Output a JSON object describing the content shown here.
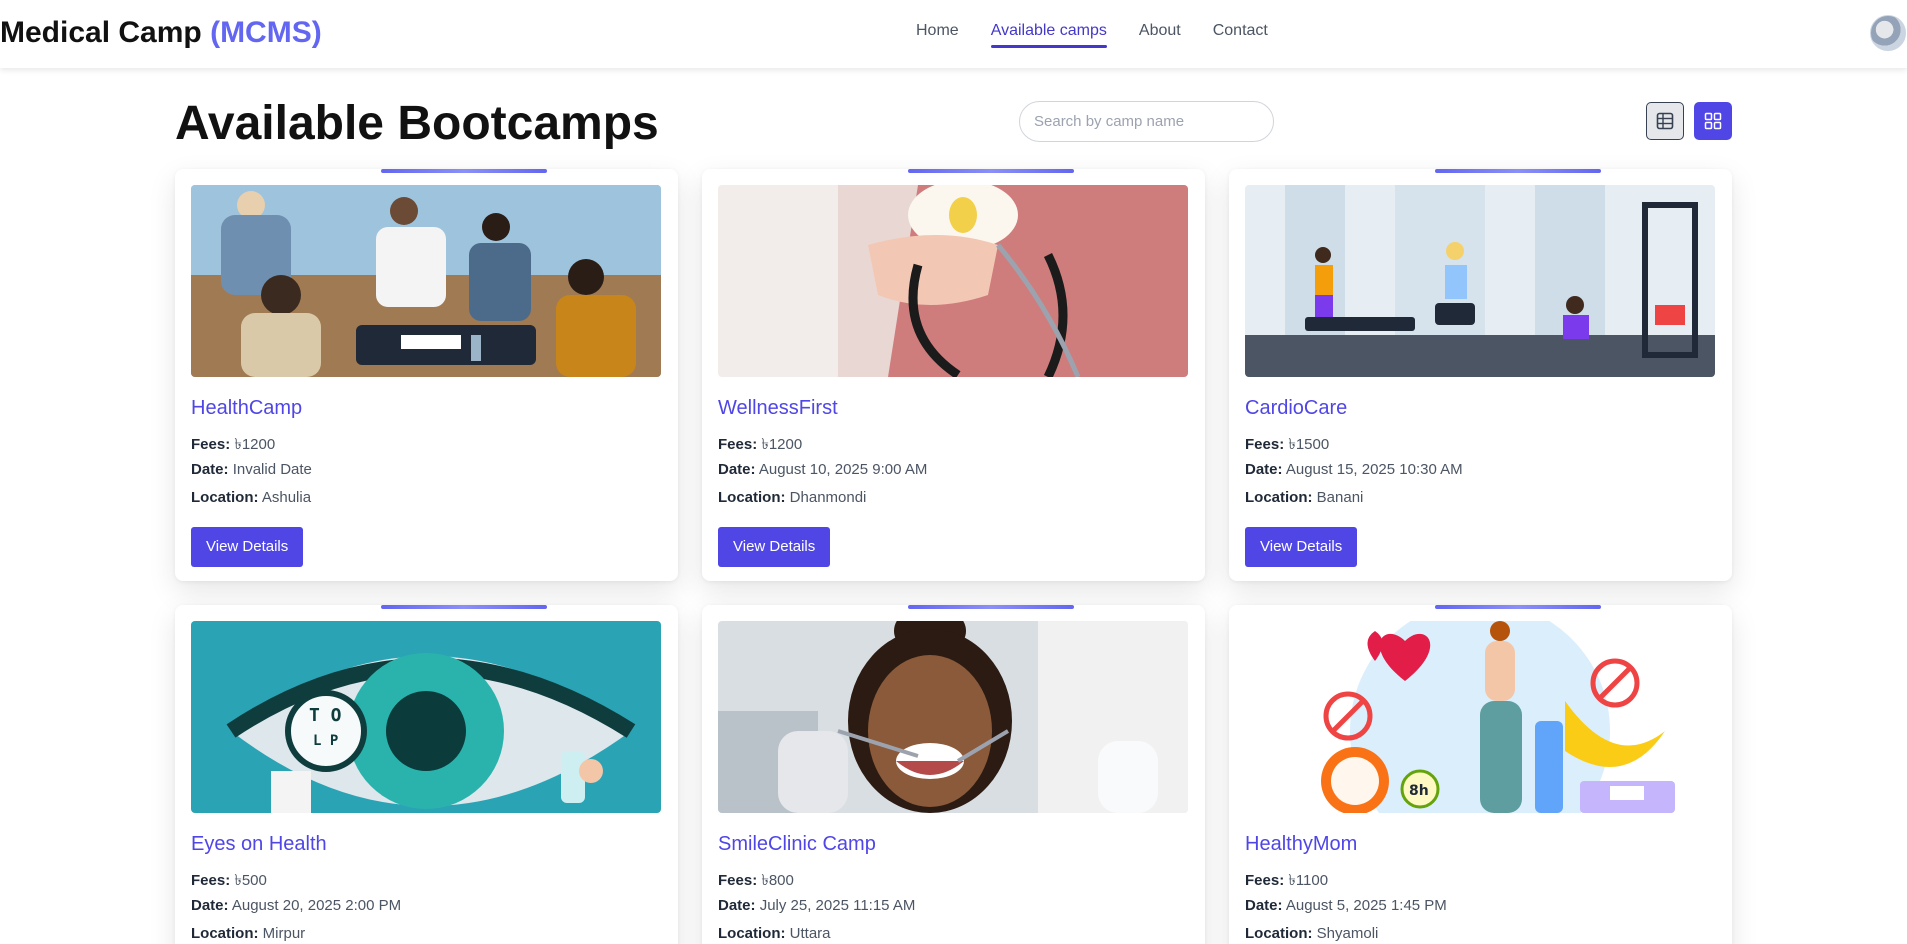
{
  "brand": {
    "name": "Medical Camp",
    "abbr": "(MCMS)"
  },
  "nav": {
    "items": [
      {
        "label": "Home"
      },
      {
        "label": "Available camps"
      },
      {
        "label": "About"
      },
      {
        "label": "Contact"
      }
    ],
    "active": "Available camps"
  },
  "page": {
    "title": "Available Bootcamps"
  },
  "search": {
    "placeholder": "Search by camp name",
    "value": ""
  },
  "view_toggle": {
    "table_icon": "table-view-icon",
    "grid_icon": "grid-view-icon",
    "selected": "grid"
  },
  "labels": {
    "fees": "Fees:",
    "date": "Date:",
    "location": "Location:",
    "button": "View Details"
  },
  "colors": {
    "accent": "#4f46e5",
    "brand_accent": "#6366f1"
  },
  "camps": [
    {
      "name": "HealthCamp",
      "fees": "৳1200",
      "date": "Invalid Date",
      "location": "Ashulia",
      "image": "health-camp-photo"
    },
    {
      "name": "WellnessFirst",
      "fees": "৳1200",
      "date": "August 10, 2025 9:00 AM",
      "location": "Dhanmondi",
      "image": "stethoscope-photo"
    },
    {
      "name": "CardioCare",
      "fees": "৳1500",
      "date": "August 15, 2025 10:30 AM",
      "location": "Banani",
      "image": "gym-illustration"
    },
    {
      "name": "Eyes on Health",
      "fees": "৳500",
      "date": "August 20, 2025 2:00 PM",
      "location": "Mirpur",
      "image": "eye-illustration"
    },
    {
      "name": "SmileClinic Camp",
      "fees": "৳800",
      "date": "July 25, 2025 11:15 AM",
      "location": "Uttara",
      "image": "dental-photo"
    },
    {
      "name": "HealthyMom",
      "fees": "৳1100",
      "date": "August 5, 2025 1:45 PM",
      "location": "Shyamoli",
      "image": "wellness-illustration"
    }
  ]
}
